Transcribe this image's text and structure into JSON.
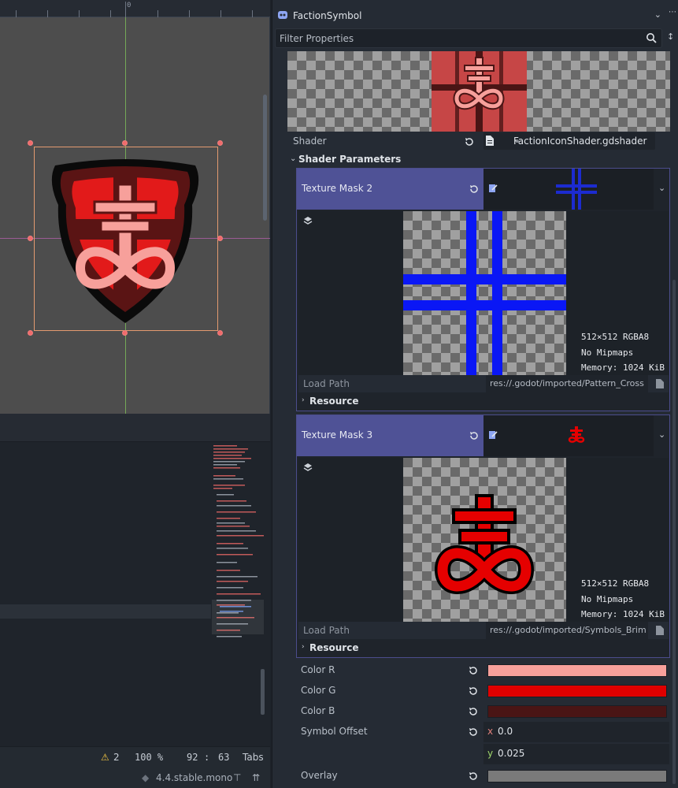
{
  "viewport": {
    "ruler_zero": "0"
  },
  "status": {
    "warnings": "2",
    "zoom": "100 %",
    "line": "92",
    "col": "63",
    "indent": "Tabs",
    "version": "4.4.stable.mono"
  },
  "inspector": {
    "object_name": "FactionSymbol",
    "filter_placeholder": "Filter Properties",
    "shader_label": "Shader",
    "shader_value": "FactionIconShader.gdshader",
    "section_title": "Shader Parameters",
    "masks": [
      {
        "label": "Texture Mask 2",
        "info_size": "512×512 RGBA8",
        "info_mip": "No Mipmaps",
        "info_mem": "Memory: 1024 KiB",
        "load_path_label": "Load Path",
        "load_path_value": "res://.godot/imported/Pattern_Cross",
        "resource_label": "Resource"
      },
      {
        "label": "Texture Mask 3",
        "info_size": "512×512 RGBA8",
        "info_mip": "No Mipmaps",
        "info_mem": "Memory: 1024 KiB",
        "load_path_label": "Load Path",
        "load_path_value": "res://.godot/imported/Symbols_Brim",
        "resource_label": "Resource"
      }
    ],
    "colors": [
      {
        "label": "Color R",
        "hex": "#f7a09b"
      },
      {
        "label": "Color G",
        "hex": "#e00000"
      },
      {
        "label": "Color B",
        "hex": "#4a1515"
      }
    ],
    "symbol_offset": {
      "label": "Symbol Offset",
      "x_axis": "x",
      "x": "0.0",
      "y_axis": "y",
      "y": "0.025"
    },
    "overlay": {
      "label": "Overlay",
      "hex": "#7a7a7a"
    }
  }
}
